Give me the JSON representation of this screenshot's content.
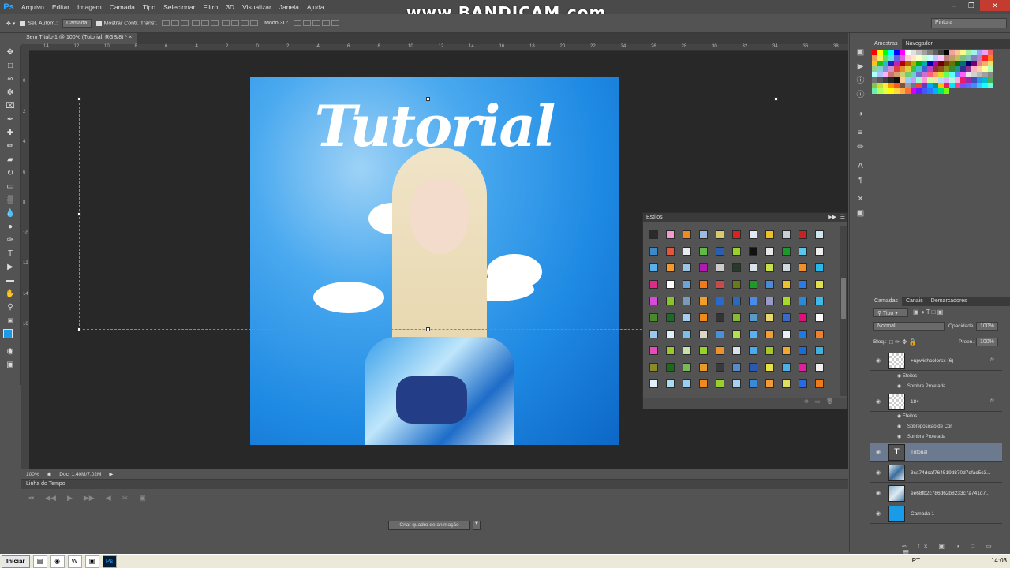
{
  "app": {
    "logo": "Ps"
  },
  "menu": [
    "Arquivo",
    "Editar",
    "Imagem",
    "Camada",
    "Tipo",
    "Selecionar",
    "Filtro",
    "3D",
    "Visualizar",
    "Janela",
    "Ajuda"
  ],
  "watermark": "www.BANDICAM.com",
  "options": {
    "auto_select_label": "Sel. Autom.:",
    "auto_select_value": "Camada",
    "show_transform_label": "Mostrar Contr. Transf.",
    "mode_3d_label": "Modo 3D:",
    "workspace": "Pintura"
  },
  "document": {
    "tab_title": "Sem Título-1 @ 100% (Tutorial, RGB/8) *",
    "image_text": "Tutorial",
    "ruler_h": [
      "14",
      "12",
      "10",
      "8",
      "6",
      "4",
      "2",
      "0",
      "2",
      "4",
      "6",
      "8",
      "10",
      "12",
      "14",
      "16",
      "18",
      "20",
      "22",
      "24",
      "26",
      "28",
      "30",
      "32",
      "34",
      "36",
      "38"
    ],
    "ruler_v": [
      "0",
      "2",
      "4",
      "6",
      "8",
      "10",
      "12",
      "14",
      "16"
    ]
  },
  "status": {
    "zoom": "100%",
    "doc_size": "Doc: 1,40M/7,02M"
  },
  "timeline": {
    "title": "Linha do Tempo",
    "create_button": "Criar quadro de animação"
  },
  "styles_panel": {
    "title": "Estilos",
    "colors": [
      "#2a2a2a",
      "#f39bd1",
      "#f08a1e",
      "#9bbbdf",
      "#d8c96a",
      "#dd2020",
      "#e0e8f0",
      "#f0c020",
      "#c8d0d8",
      "#cc1f1f",
      "#cfe6ee",
      "#3f88c8",
      "#e2563a",
      "#e8ecef",
      "#63b84a",
      "#2a5fae",
      "#9ad02a",
      "#111111",
      "#e8e8e8",
      "#1a9a2a",
      "#5ac8e8",
      "#eeeeee",
      "#5ab0e8",
      "#f39a2a",
      "#9cc4e4",
      "#b01ab0",
      "#cccccc",
      "#2a3a2a",
      "#d8e4ea",
      "#c8e04a",
      "#d0d8e0",
      "#f0902a",
      "#2ab8e8",
      "#e02a8a",
      "#ffffff",
      "#6aa4d8",
      "#f07a1a",
      "#c84a4a",
      "#6a7a1a",
      "#1e9a2a",
      "#4a8ad8",
      "#f0c02a",
      "#2a7ae8",
      "#e0e04a",
      "#d84ad8",
      "#8ac42a",
      "#7a9ab8",
      "#f0a02a",
      "#2a6ac8",
      "#2a6ab8",
      "#4a8ae8",
      "#9a9ac8",
      "#a8d82a",
      "#2a8ad8",
      "#40b8e8",
      "#4a8a2a",
      "#1a6a2a",
      "#aaccee",
      "#f08a1a",
      "#333333",
      "#88bb33",
      "#5a9ac8",
      "#e8d870",
      "#3a6ac8",
      "#e0107a",
      "#ffffff",
      "#9ac8f0",
      "#dff0fa",
      "#7ac0e8",
      "#dcd4c4",
      "#4a90d8",
      "#b4e04a",
      "#5ab0f0",
      "#f0a030",
      "#eaf0f4",
      "#1a7ae8",
      "#f0802a",
      "#e84ab8",
      "#9ac82a",
      "#c8e0aa",
      "#9ad02a",
      "#f0902a",
      "#d8e0ea",
      "#4aaaf0",
      "#a8c82a",
      "#f0a830",
      "#1a6ad8",
      "#40b0e0",
      "#8a8a2a",
      "#1a6a1a",
      "#7ab858",
      "#e89a2a",
      "#3a3a3a",
      "#5a8ac8",
      "#2a5ab0",
      "#e8e048",
      "#4ab0e8",
      "#e0209a",
      "#f0f0f0",
      "#dff0fa",
      "#aaddf0",
      "#9ad0f0",
      "#f08a1e",
      "#9ad02a",
      "#a8d0f0",
      "#3a8ad8",
      "#f09a3a",
      "#e0e060",
      "#2a6ae0",
      "#f07a1a"
    ]
  },
  "swatches_panel": {
    "tabs": [
      "Amostras",
      "Navegador"
    ],
    "colors": [
      "#ff0000",
      "#ffff00",
      "#00ff00",
      "#00ffff",
      "#0000ff",
      "#ff00ff",
      "#ffffff",
      "#e0e0e0",
      "#c0c0c0",
      "#a0a0a0",
      "#808080",
      "#606060",
      "#404040",
      "#000000",
      "#f4a0a0",
      "#f8c890",
      "#f8f890",
      "#a0f0a0",
      "#a0f0f0",
      "#a0a0f0",
      "#f0a0f0",
      "#f06060",
      "#f0a050",
      "#f0f060",
      "#60e060",
      "#60e0e0",
      "#6060e0",
      "#e060e0",
      "#ffd0d0",
      "#ffe8c8",
      "#ffffc8",
      "#c8ffc8",
      "#c8ffff",
      "#c8c8ff",
      "#ffc8ff",
      "#c08080",
      "#c0a060",
      "#c0c060",
      "#80c080",
      "#80c0c0",
      "#8080c0",
      "#c080c0",
      "#ff2020",
      "#ff8020",
      "#ffc020",
      "#20c020",
      "#20c0c0",
      "#2020c0",
      "#c020c0",
      "#b00000",
      "#b06000",
      "#b0b000",
      "#00b000",
      "#00b0b0",
      "#0000b0",
      "#b000b0",
      "#700000",
      "#704000",
      "#707000",
      "#007000",
      "#007070",
      "#000070",
      "#700070",
      "#f08080",
      "#f0b070",
      "#f0e070",
      "#90d090",
      "#80d0d0",
      "#8090e0",
      "#d090d0",
      "#e04040",
      "#e09030",
      "#e0d040",
      "#40c040",
      "#40c0d0",
      "#4060d0",
      "#c040c0",
      "#903030",
      "#905020",
      "#909020",
      "#309030",
      "#209090",
      "#303090",
      "#903090",
      "#ffb0c0",
      "#ffd0a0",
      "#ffffa0",
      "#b0ffb0",
      "#b0ffff",
      "#b0c0ff",
      "#ffb0ff",
      "#d07070",
      "#d0a070",
      "#d0d070",
      "#70d070",
      "#70d0d0",
      "#7070d0",
      "#d070d0",
      "#ff6080",
      "#ffa060",
      "#e0e020",
      "#60ff60",
      "#60ffff",
      "#6080ff",
      "#ff60ff",
      "#e8e8e8",
      "#d0d0d0",
      "#b8b8b8",
      "#a0a0a0",
      "#888888",
      "#707070",
      "#585858",
      "#404040",
      "#282828",
      "#101010",
      "#ffcc99",
      "#99ccff",
      "#cc99ff",
      "#99ffcc",
      "#ff99cc",
      "#ccff99",
      "#f8e0b0",
      "#b0e0f8",
      "#e0b0f8",
      "#b0f8e0",
      "#f8b0e0",
      "#e81e63",
      "#9c27b0",
      "#3f51b5",
      "#2196f3",
      "#00bcd4",
      "#4caf50",
      "#8bc34a",
      "#cddc39",
      "#ffeb3b",
      "#ff9800",
      "#ff5722",
      "#795548",
      "#9e9e9e",
      "#607d8b",
      "#f44336",
      "#673ab7",
      "#03a9f4",
      "#009688",
      "#ffc107",
      "#e91e63",
      "#00e5ff",
      "#ff4081",
      "#7c4dff",
      "#536dfe",
      "#448aff",
      "#40c4ff",
      "#18ffff",
      "#64ffda",
      "#69f0ae",
      "#b2ff59",
      "#eeff41",
      "#ffff00",
      "#ffd740",
      "#ffab40",
      "#ff6e40",
      "#d500f9",
      "#651fff",
      "#3d5afe",
      "#2979ff",
      "#00b0ff",
      "#00e676",
      "#76ff03"
    ]
  },
  "layers_panel": {
    "tabs": [
      "Camadas",
      "Canais",
      "Demarcadores"
    ],
    "kind_filter": "Tipo",
    "blend_mode": "Normal",
    "opacity_label": "Opacidade:",
    "opacity_value": "100%",
    "lock_label": "Bloq.:",
    "fill_label": "Preen.:",
    "fill_value": "100%",
    "layers": [
      {
        "name": "+upwishcolorsx (6)",
        "fx": "fx",
        "effects_label": "Efeitos",
        "effects": [
          "Sombra Projetada"
        ]
      },
      {
        "name": "184",
        "fx": "fx",
        "effects_label": "Efeitos",
        "effects": [
          "Sobreposição de Cor",
          "Sombra Projetada"
        ]
      },
      {
        "name": "Tutorial",
        "type_glyph": "T"
      },
      {
        "name": "3ca74dcaf764519d870d7dfac5c3..."
      },
      {
        "name": "ee68fb2c786d62b8233c7a741d7..."
      },
      {
        "name": "Camada 1"
      }
    ]
  },
  "taskbar": {
    "start": "Iniciar",
    "lang": "PT",
    "time": "14:03"
  }
}
